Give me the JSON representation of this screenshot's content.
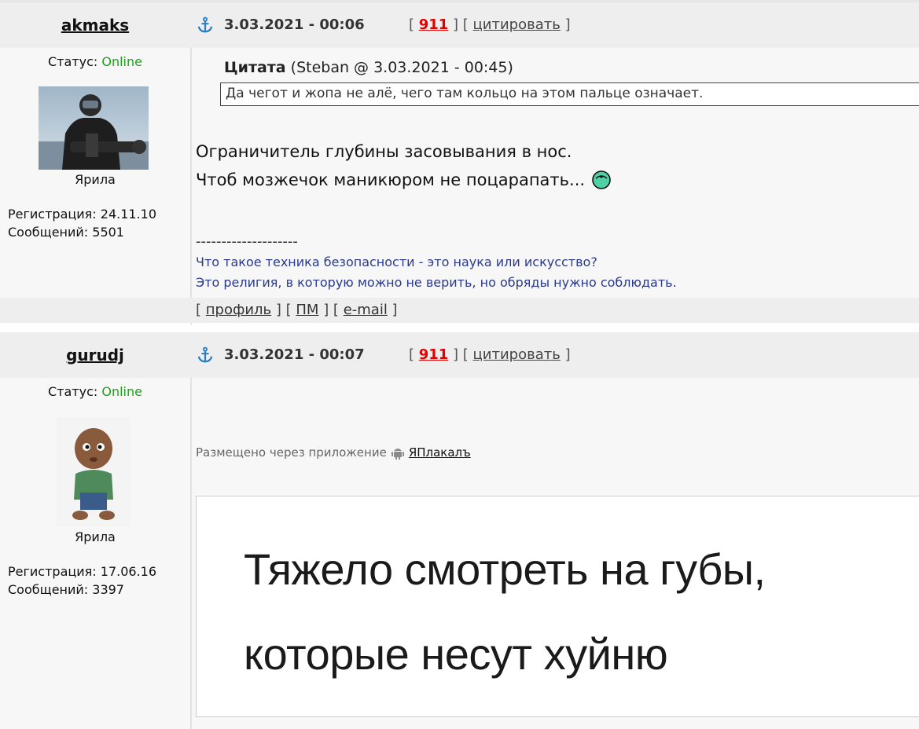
{
  "posts": [
    {
      "author": "akmaks",
      "date": "3.03.2021 - 00:06",
      "rank_num": "911",
      "quote_label": "цитировать",
      "status_label": "Статус:",
      "status_value": "Online",
      "user_rank": "Ярила",
      "registration": "Регистрация: 24.11.10",
      "messages": "Сообщений: 5501",
      "quote": {
        "title": "Цитата",
        "meta": "(Steban @ 3.03.2021 - 00:45)",
        "text": "Да чегот и жопа не алё, чего там кольцо на этом пальце означает."
      },
      "body_lines": [
        "Ограничитель глубины засовывания в нос.",
        "Чтоб мозжечок маникюром не поцарапать..."
      ],
      "signature_dash": "--------------------",
      "signature_lines": [
        "Что такое техника безопасности - это наука или искусство?",
        "Это религия, в которую можно не верить, но обряды нужно соблюдать."
      ],
      "footer_links": {
        "profile": "профиль",
        "pm": "ПМ",
        "email": "e-mail"
      }
    },
    {
      "author": "gurudj",
      "date": "3.03.2021 - 00:07",
      "rank_num": "911",
      "quote_label": "цитировать",
      "status_label": "Статус:",
      "status_value": "Online",
      "user_rank": "Ярила",
      "registration": "Регистрация: 17.06.16",
      "messages": "Сообщений: 3397",
      "app_note": "Размещено через приложение",
      "app_name": "ЯПлакалъ",
      "meme_lines": [
        "Тяжело смотреть на губы,",
        "которые несут хуйню"
      ]
    }
  ],
  "icons": {
    "anchor": "anchor-icon",
    "smiley": "smiley-icon",
    "android": "android-icon"
  },
  "colors": {
    "online": "#1aa31a",
    "rank": "#e00000",
    "signature": "#2a3a8c",
    "header_bg": "#eeeeee"
  }
}
